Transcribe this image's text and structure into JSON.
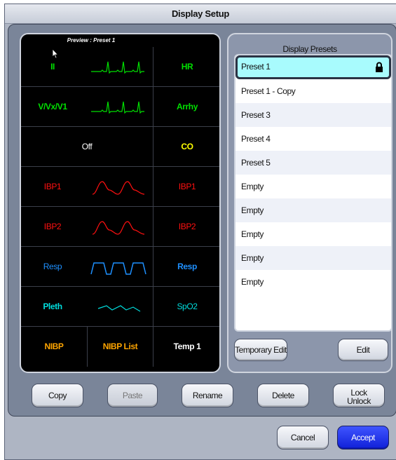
{
  "window": {
    "title": "Display Setup"
  },
  "preview": {
    "title": "Preview :  Preset 1",
    "rows": [
      {
        "left": "II",
        "right": "HR",
        "color": "#00e000",
        "wave": "ecg"
      },
      {
        "left": "V/Vx/V1",
        "right": "Arrhy",
        "color": "#00e000",
        "wave": "ecg"
      },
      {
        "center": "Off",
        "right": "CO",
        "color": "#ffffff",
        "right_color": "#ffff00"
      },
      {
        "left": "IBP1",
        "right": "IBP1",
        "color": "#ff1010",
        "wave": "ibp"
      },
      {
        "left": "IBP2",
        "right": "IBP2",
        "color": "#ff1010",
        "wave": "ibp"
      },
      {
        "left": "Resp",
        "right": "Resp",
        "color": "#1e90ff",
        "wave": "resp"
      },
      {
        "left": "Pleth",
        "right": "SpO2",
        "color": "#00dddd",
        "wave": "pleth"
      },
      {
        "left": "NIBP",
        "mid": "NIBP List",
        "right": "Temp 1",
        "color": "#ffa500",
        "right_color": "#ffffff"
      }
    ]
  },
  "presets": {
    "title": "Display Presets",
    "items": [
      "Preset 1",
      "Preset 1 - Copy",
      "Preset 3",
      "Preset 4",
      "Preset 5",
      "Empty",
      "Empty",
      "Empty",
      "Empty",
      "Empty"
    ],
    "selected_index": 0,
    "locked_icon": "lock-icon",
    "temporary_edit_label": "Temporary Edit",
    "edit_label": "Edit"
  },
  "actions": {
    "copy": "Copy",
    "paste": "Paste",
    "rename": "Rename",
    "delete": "Delete",
    "lock_line1": "Lock",
    "lock_line2": "Unlock"
  },
  "footer": {
    "cancel": "Cancel",
    "accept": "Accept"
  },
  "colors": {
    "selected_row": "#a8fbfd",
    "accept_button": "#1a2cf0",
    "panel": "#7a8599"
  }
}
